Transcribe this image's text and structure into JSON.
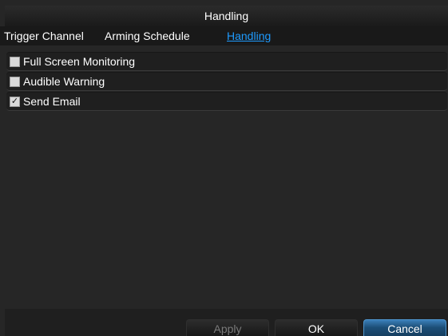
{
  "dialog": {
    "title": "Handling"
  },
  "tabs": [
    {
      "label": "Trigger Channel",
      "active": false
    },
    {
      "label": "Arming Schedule",
      "active": false
    },
    {
      "label": "Handling",
      "active": true
    }
  ],
  "options": [
    {
      "label": "Full Screen Monitoring",
      "checked": false
    },
    {
      "label": "Audible Warning",
      "checked": false
    },
    {
      "label": "Send Email",
      "checked": true
    }
  ],
  "buttons": {
    "apply": "Apply",
    "ok": "OK",
    "cancel": "Cancel"
  },
  "colors": {
    "active_tab": "#1e9bff",
    "background": "#262626",
    "primary_button": "#1c4e76"
  }
}
